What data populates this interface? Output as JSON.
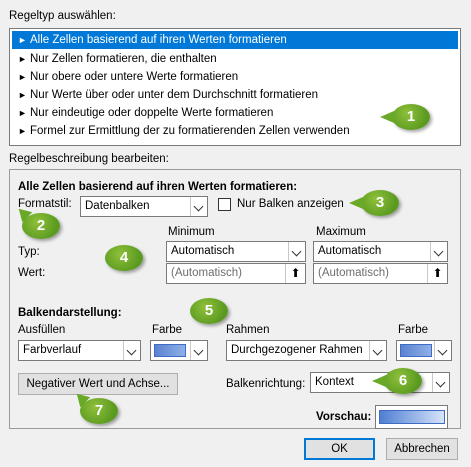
{
  "rule_type_label": "Regeltyp auswählen:",
  "rule_types": [
    "Alle Zellen basierend auf ihren Werten formatieren",
    "Nur Zellen formatieren, die enthalten",
    "Nur obere oder untere Werte formatieren",
    "Nur Werte über oder unter dem Durchschnitt formatieren",
    "Nur eindeutige oder doppelte Werte formatieren",
    "Formel zur Ermittlung der zu formatierenden Zellen verwenden"
  ],
  "list_arrow": "►",
  "description_label": "Regelbeschreibung bearbeiten:",
  "description_heading": "Alle Zellen basierend auf ihren Werten formatieren:",
  "format_style": {
    "label": "Formatstil:",
    "value": "Datenbalken"
  },
  "show_bar_only": {
    "label": "Nur Balken anzeigen",
    "checked": false
  },
  "minimum": {
    "header": "Minimum",
    "type": "Automatisch",
    "value": "(Automatisch)"
  },
  "maximum": {
    "header": "Maximum",
    "type": "Automatisch",
    "value": "(Automatisch)"
  },
  "type_label": "Typ:",
  "value_label": "Wert:",
  "bar_appearance_label": "Balkendarstellung:",
  "fill": {
    "label": "Ausfüllen",
    "value": "Farbverlauf"
  },
  "fill_color_label": "Farbe",
  "border": {
    "label": "Rahmen",
    "value": "Durchgezogener Rahmen"
  },
  "border_color_label": "Farbe",
  "negative_button": "Negativer Wert und Achse...",
  "bar_direction": {
    "label": "Balkenrichtung:",
    "value": "Kontext"
  },
  "preview_label": "Vorschau:",
  "ok_button": "OK",
  "cancel_button": "Abbrechen",
  "callouts": [
    "1",
    "2",
    "3",
    "4",
    "5",
    "6",
    "7"
  ],
  "colors": {
    "selection": "#0078d7",
    "bar": "#5b82d0",
    "callout": "#6aa828"
  }
}
